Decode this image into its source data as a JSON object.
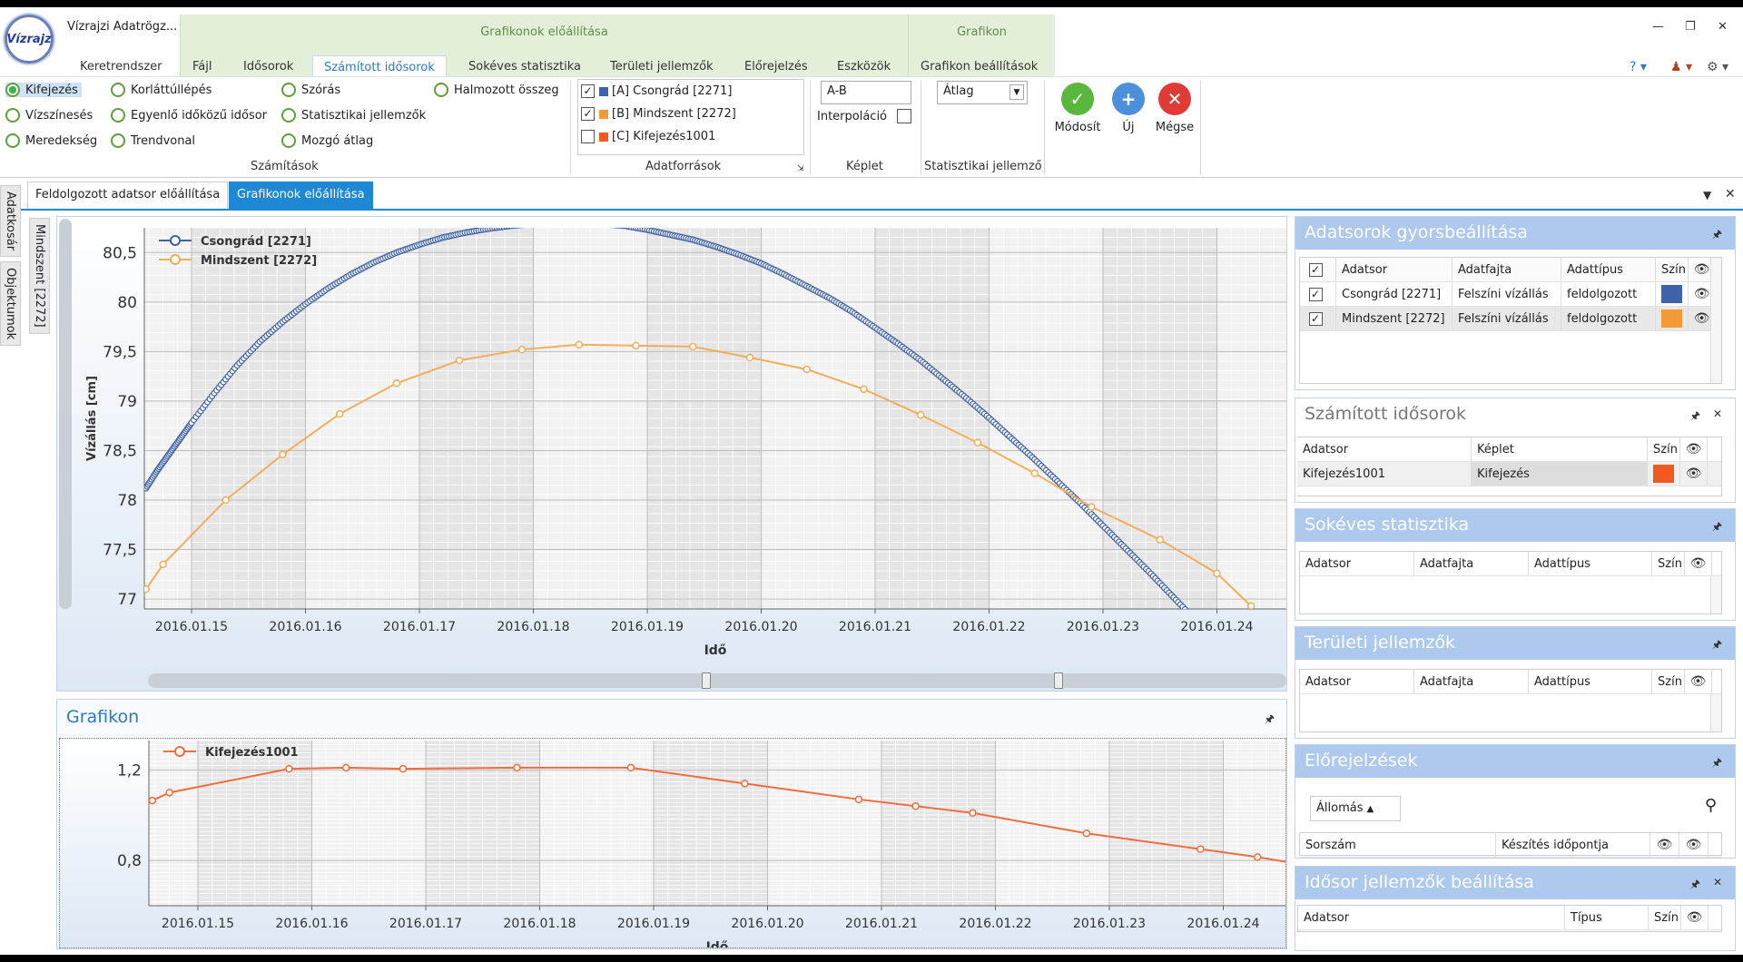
{
  "app": {
    "title": "Vízrajzi Adatrögz...",
    "logo_text": "Vízrajz"
  },
  "context_tabs": {
    "group1": "Grafikonok előállítása",
    "group2": "Grafikon"
  },
  "tabs": [
    "Keretrendszer",
    "Fájl",
    "Idősorok",
    "Számított idősorok",
    "Sokéves statisztika",
    "Területi jellemzők",
    "Előrejelzés",
    "Eszközök",
    "Grafikon beállítások"
  ],
  "active_tab": "Számított idősorok",
  "ribbon": {
    "calc_options": [
      "Kifejezés",
      "Vízszínesés",
      "Meredekség",
      "Korláttúllépés",
      "Egyenlő időközű idősor",
      "Trendvonal",
      "Szórás",
      "Statisztikai jellemzők",
      "Mozgó átlag",
      "Halmozott összeg"
    ],
    "calc_selected": "Kifejezés",
    "calc_group_label": "Számítások",
    "datasources": [
      {
        "label": "[A] Csongrád [2271]",
        "checked": true,
        "color": "#3f63a8"
      },
      {
        "label": "[B] Mindszent [2272]",
        "checked": true,
        "color": "#f29a38"
      },
      {
        "label": "[C] Kifejezés1001",
        "checked": false,
        "color": "#f05a1e"
      }
    ],
    "datasources_label": "Adatforrások",
    "formula_value": "A-B",
    "interpolation_label": "Interpoláció",
    "formula_label": "Képlet",
    "stat_value": "Átlag",
    "stat_label": "Statisztikai jellemző",
    "buttons": {
      "modify": "Módosít",
      "new": "Új",
      "cancel": "Mégse"
    }
  },
  "doc_tabs": [
    "Feldolgozott adatsor előállítása",
    "Grafikonok előállítása"
  ],
  "side_tabs": [
    "Adatkosár",
    "Objektumok",
    "Mindszent [2272]"
  ],
  "chart_data": [
    {
      "type": "line",
      "title": "",
      "xlabel": "Idő",
      "ylabel": "Vízállás [cm]",
      "categories": [
        "2016.01.15",
        "2016.01.16",
        "2016.01.17",
        "2016.01.18",
        "2016.01.19",
        "2016.01.20",
        "2016.01.21",
        "2016.01.22",
        "2016.01.23",
        "2016.01.24"
      ],
      "ylim": [
        76.9,
        80.75
      ],
      "yticks": [
        "80,5",
        "80",
        "79,5",
        "79",
        "78,5",
        "78",
        "77,5",
        "77"
      ],
      "ytick_values": [
        80.5,
        80,
        79.5,
        79,
        78.5,
        78,
        77.5,
        77
      ],
      "series": [
        {
          "name": "Csongrád [2271]",
          "color": "#3f63a8",
          "x": [
            -0.4,
            -0.3,
            -0.2,
            -0.1,
            0,
            0.2,
            0.4,
            0.6,
            0.8,
            1,
            1.2,
            1.4,
            1.6,
            1.8,
            2,
            2.2,
            2.4,
            2.6,
            2.8,
            3,
            3.2,
            3.4,
            3.6,
            3.8,
            4,
            4.2,
            4.4,
            4.6,
            4.8,
            5,
            5.2,
            5.4,
            5.6,
            5.8,
            6,
            6.2,
            6.4,
            6.6,
            6.8,
            7,
            7.2,
            7.4,
            7.6,
            7.8,
            8,
            8.2,
            8.4,
            8.6,
            8.8,
            9,
            9.2,
            9.4,
            9.6
          ],
          "values": [
            78.12,
            78.3,
            78.46,
            78.62,
            78.78,
            79.08,
            79.36,
            79.6,
            79.8,
            79.98,
            80.14,
            80.28,
            80.4,
            80.5,
            80.58,
            80.65,
            80.7,
            80.74,
            80.77,
            80.79,
            80.8,
            80.8,
            80.79,
            80.77,
            80.73,
            80.68,
            80.63,
            80.56,
            80.48,
            80.39,
            80.28,
            80.16,
            80.04,
            79.9,
            79.74,
            79.58,
            79.41,
            79.22,
            79.03,
            78.83,
            78.62,
            78.41,
            78.19,
            77.97,
            77.74,
            77.51,
            77.28,
            77.04,
            76.8,
            76.6,
            76.4,
            76.2,
            76.0
          ]
        },
        {
          "name": "Mindszent [2272]",
          "color": "#f4ad5a",
          "x": [
            -0.4,
            -0.25,
            0.3,
            0.8,
            1.3,
            1.8,
            2.35,
            2.9,
            3.4,
            3.9,
            4.4,
            4.9,
            5.4,
            5.9,
            6.4,
            6.9,
            7.4,
            7.9,
            8.5,
            9,
            9.3
          ],
          "values": [
            77.1,
            77.35,
            78.0,
            78.46,
            78.87,
            79.18,
            79.41,
            79.52,
            79.57,
            79.56,
            79.55,
            79.44,
            79.32,
            79.12,
            78.86,
            78.58,
            78.27,
            77.93,
            77.6,
            77.26,
            76.93
          ]
        }
      ]
    },
    {
      "type": "line",
      "title": "Grafikon",
      "xlabel": "Idő",
      "ylabel": "",
      "categories": [
        "2016.01.15",
        "2016.01.16",
        "2016.01.17",
        "2016.01.18",
        "2016.01.19",
        "2016.01.20",
        "2016.01.21",
        "2016.01.22",
        "2016.01.23",
        "2016.01.24"
      ],
      "ylim": [
        0.6,
        1.33
      ],
      "yticks": [
        "1,2",
        "0,8"
      ],
      "ytick_values": [
        1.2,
        0.8
      ],
      "series": [
        {
          "name": "Kifejezés1001",
          "color": "#f26d3d",
          "x": [
            -0.4,
            -0.25,
            0.8,
            1.3,
            1.8,
            2.8,
            3.8,
            4.8,
            5.8,
            6.3,
            6.8,
            7.8,
            8.8,
            9.3,
            9.6
          ],
          "values": [
            1.065,
            1.1,
            1.205,
            1.21,
            1.205,
            1.21,
            1.21,
            1.14,
            1.07,
            1.04,
            1.01,
            0.92,
            0.85,
            0.815,
            0.79
          ]
        }
      ]
    }
  ],
  "right_panels": {
    "quick": {
      "title": "Adatsorok gyorsbeállítása",
      "cols": [
        "Adatsor",
        "Adatfajta",
        "Adattípus",
        "Szín"
      ],
      "rows": [
        {
          "name": "Csongrád [2271]",
          "kind": "Felszíni vízállás",
          "type": "feldolgozott",
          "color": "#3f63a8"
        },
        {
          "name": "Mindszent [2272]",
          "kind": "Felszíni vízállás",
          "type": "feldolgozott",
          "color": "#f29a38"
        }
      ]
    },
    "computed": {
      "title": "Számított idősorok",
      "cols": [
        "Adatsor",
        "Képlet",
        "Szín"
      ],
      "rows": [
        {
          "name": "Kifejezés1001",
          "formula": "Kifejezés",
          "color": "#f05a1e"
        }
      ]
    },
    "longterm": {
      "title": "Sokéves statisztika",
      "cols": [
        "Adatsor",
        "Adatfajta",
        "Adattípus",
        "Szín"
      ]
    },
    "area": {
      "title": "Területi jellemzők",
      "cols": [
        "Adatsor",
        "Adatfajta",
        "Adattípus",
        "Szín"
      ]
    },
    "forecast": {
      "title": "Előrejelzések",
      "station": "Állomás",
      "cols": [
        "Sorszám",
        "Készítés időpontja"
      ]
    },
    "series_settings": {
      "title": "Idősor jellemzők beállítása",
      "cols": [
        "Adatsor",
        "Típus",
        "Szín"
      ]
    }
  }
}
